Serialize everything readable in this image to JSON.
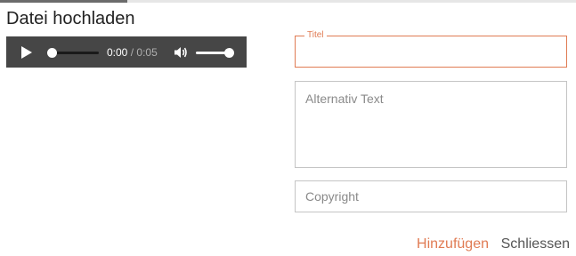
{
  "dialog": {
    "title": "Datei hochladen"
  },
  "audio_player": {
    "current_time": "0:00",
    "separator": "/",
    "duration": "0:05",
    "progress_fraction": 0.0,
    "volume_fraction": 0.8
  },
  "form": {
    "titel_label": "Titel",
    "titel_value": "",
    "alt_text_placeholder": "Alternativ Text",
    "copyright_placeholder": "Copyright"
  },
  "actions": {
    "add_label": "Hinzufügen",
    "close_label": "Schliessen"
  },
  "colors": {
    "accent": "#e07b53",
    "player_bg": "#464646"
  }
}
